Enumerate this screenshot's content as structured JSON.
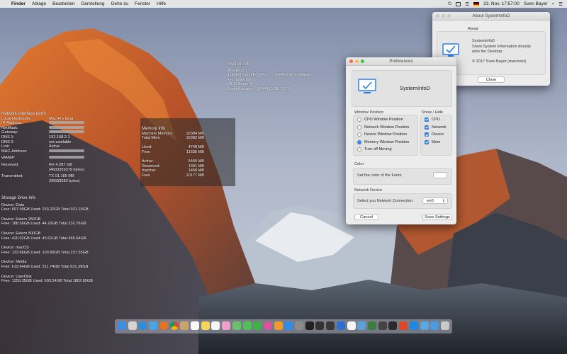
{
  "menubar": {
    "apple": "",
    "items": [
      "Finder",
      "Ablage",
      "Bearbeiten",
      "Darstellung",
      "Gehe zu",
      "Fenster",
      "Hilfe"
    ],
    "datetime": "23. Nov.  17:57:00",
    "user": "Sven Bayer",
    "battery_glyph": "⏻",
    "list_glyph": "☰"
  },
  "system_info": {
    "title": "System Info",
    "model": "MacPro3,1",
    "cpu": "Intel(R) Xeon(R) CPU",
    "cpu_model": "E5462 @ 2.80GHz",
    "vendor": "GenuineIntel",
    "cores": "CPU Cores 4",
    "load_label": "Load Average:",
    "load_value": "(2.44) (5.11) (3.76)"
  },
  "network": {
    "title": "Network Interface (en0)",
    "rows": [
      {
        "k": "Local Hostname:",
        "v": "Mac-Pro.local"
      },
      {
        "k": "IP-Address:",
        "v": ""
      },
      {
        "k": "NetMask:",
        "v": ""
      },
      {
        "k": "Gateway:",
        "v": ""
      },
      {
        "k": "DNS 1:",
        "v": "192.168.2.1"
      },
      {
        "k": "DNS 2:",
        "v": "not available"
      },
      {
        "k": "Link:",
        "v": "Active"
      },
      {
        "k": "MAC-Address:",
        "v": ""
      }
    ],
    "wanip_label": "WANIP:",
    "received_label": "Received:",
    "received_1": "RX 4.287 GB",
    "received_2": "(4603359379 bytes)",
    "transmitted_label": "Transmitted:",
    "transmitted_1": "TX 91.165 MB",
    "transmitted_2": "(95593582 bytes)"
  },
  "memory": {
    "title": "Memory Info",
    "rows": [
      {
        "k": "Machine Memory",
        "v": "16384 MB"
      },
      {
        "k": "Total Mem",
        "v": "16382 MB"
      },
      {
        "k": "",
        "v": ""
      },
      {
        "k": "Used:",
        "v": "4748 MB"
      },
      {
        "k": "Free",
        "v": "11635 MB"
      },
      {
        "k": "",
        "v": ""
      },
      {
        "k": "Active:",
        "v": "5445 MB"
      },
      {
        "k": "Reserved:",
        "v": "1301 MB"
      },
      {
        "k": "Inactive:",
        "v": "1458 MB"
      },
      {
        "k": "Free",
        "v": "10177 MB"
      }
    ]
  },
  "storage": {
    "title": "Storage Drive Info",
    "drives": [
      {
        "name": "Device: Data",
        "stats": "Free: 697.99GB Used: 233.20GB Total 931.19GB"
      },
      {
        "name": "Device: Extern 250GB",
        "stats": "Free: 188.56GB Used: 44.20GB Total 232.76GB"
      },
      {
        "name": "Device: Extern 500GB",
        "stats": "Free: 420.02GB Used: 45.61GB Total 465.64GB"
      },
      {
        "name": "Device: macOS",
        "stats": "Free: 133.66GB Used: 103.89GB Total 237.55GB"
      },
      {
        "name": "Device: Media",
        "stats": "Free: 619.64GB Used: 311.74GB Total 931.39GB"
      },
      {
        "name": "Device: UserDisk",
        "stats": "Free: 1259.35GB Used: 603.54GB Total 1862.89GB"
      }
    ]
  },
  "preferences": {
    "title": "Preferences",
    "app_name": "SystemInfoD",
    "window_position_title": "Window Position",
    "window_positions": [
      {
        "label": "CPU Window Position",
        "selected": false
      },
      {
        "label": "Network Window Position",
        "selected": false
      },
      {
        "label": "Device Window Position",
        "selected": false
      },
      {
        "label": "Memory Window Position",
        "selected": true
      },
      {
        "label": "Turn off Moving",
        "selected": false
      }
    ],
    "show_hide_title": "Show / Hide",
    "show_hide": [
      {
        "label": "CPU",
        "checked": true
      },
      {
        "label": "Network",
        "checked": true
      },
      {
        "label": "Device",
        "checked": true
      },
      {
        "label": "Mem",
        "checked": true
      }
    ],
    "color_title": "Color",
    "color_text": "Set the color of the Fonts",
    "network_title": "Network Device",
    "network_text": "Select you Network Connection",
    "network_value": "en0",
    "cancel_label": "Cancel",
    "save_label": "Save Settings"
  },
  "about": {
    "title": "About SystemInfoD",
    "section": "About",
    "name": "SystemInfoD",
    "desc1": "Show System Information directly",
    "desc2": "onto the Desktop.",
    "copyright": "© 2017 Sven Bayer (macsven)",
    "close_label": "Close"
  },
  "dock": {
    "icons": [
      "finder-icon",
      "launchpad-icon",
      "safari-icon",
      "mail-icon",
      "firefox-icon",
      "chrome-icon",
      "contacts-icon",
      "calendar-icon",
      "notes-icon",
      "reminders-icon",
      "photos-icon",
      "maps-icon",
      "messages-icon",
      "facetime-icon",
      "itunes-icon",
      "ibooks-icon",
      "appstore-icon",
      "settings-icon",
      "terminal-icon",
      "console-icon",
      "activity-icon",
      "xcode-icon",
      "textedit-icon",
      "preview-icon",
      "atom-icon",
      "camera-icon",
      "quicktime-icon",
      "ccleaner-icon",
      "systeminfod-icon",
      "folder-icon",
      "downloads-icon",
      "trash-icon"
    ],
    "colors": [
      "#3c8fe8",
      "#d4d4d4",
      "#2a8fe0",
      "#4aa3e8",
      "#e8731f",
      "#e9e9e9",
      "#caa56a",
      "#fafafa",
      "#f3d65b",
      "#f5f5f5",
      "#f0a0c8",
      "#6cc06a",
      "#4fbf5a",
      "#3fb04a",
      "#e0509f",
      "#f29a2a",
      "#2d8de8",
      "#8c8c8c",
      "#222222",
      "#333333",
      "#3a3a3a",
      "#2f6fd0",
      "#f4f4f4",
      "#5ba0d8",
      "#3b7d3e",
      "#444444",
      "#2b2b2b",
      "#d9482b",
      "#1e88e5",
      "#5aa7e0",
      "#4b9be0",
      "#c9c9c9"
    ]
  }
}
